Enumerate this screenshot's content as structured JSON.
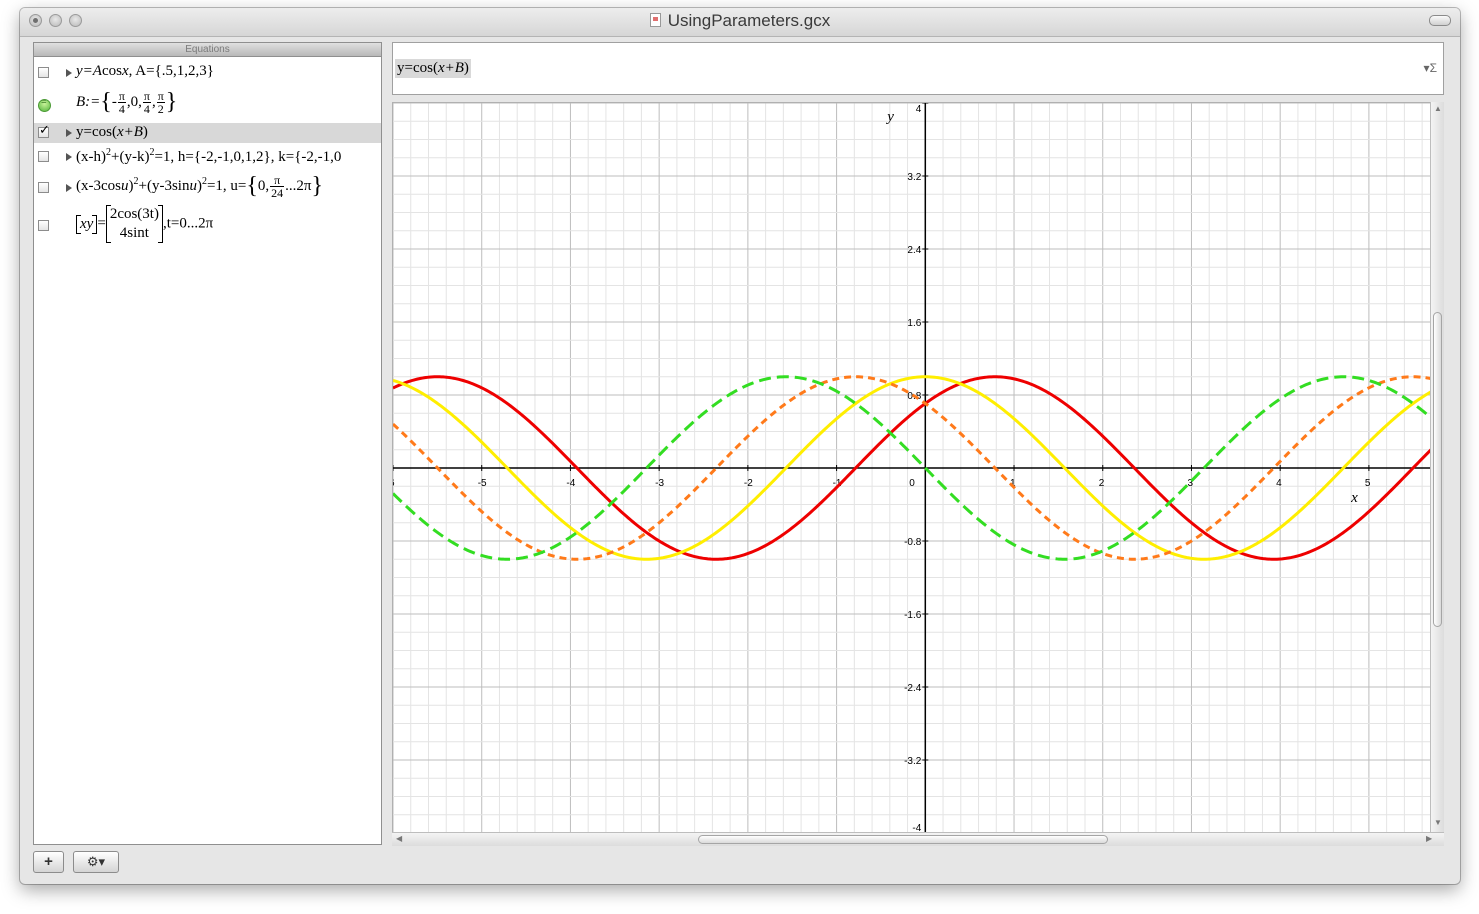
{
  "window": {
    "title": "UsingParameters.gcx"
  },
  "equations_panel": {
    "header": "Equations",
    "rows": [
      {
        "checked": false,
        "kind": "equation",
        "parts": [
          "y=A",
          "cos",
          "x",
          ", A={.5,1,2,3}"
        ]
      },
      {
        "kind": "parameter",
        "lhs": "B:=",
        "values": [
          "-",
          "π",
          "4",
          ",0,",
          "π",
          "4",
          ",",
          "π",
          "2"
        ]
      },
      {
        "checked": true,
        "kind": "equation",
        "parts": [
          "y=cos(",
          "x+B",
          ")"
        ]
      },
      {
        "checked": false,
        "kind": "equation",
        "parts": [
          "(x-h)",
          "2",
          "+(y-k)",
          "2",
          "=1, h={-2,-1,0,1,2}, k={-2,-1,0"
        ]
      },
      {
        "checked": false,
        "kind": "equation",
        "parts": [
          "(x-3cos",
          "u",
          ")",
          "2",
          "+(y-3sin",
          "u",
          ")",
          "2",
          "=1, u=",
          "0,",
          "π",
          "24",
          "...2π"
        ]
      },
      {
        "checked": false,
        "kind": "parametric",
        "matrix_left": [
          "x",
          "y"
        ],
        "matrix_right": [
          "2cos(3t)",
          "4sint"
        ],
        "range": ",t=0...2π"
      }
    ]
  },
  "input_bar": {
    "equation_prefix": "y=cos(",
    "equation_var": "x+B",
    "equation_suffix": ")",
    "sigma_label": "Σ"
  },
  "bottom_bar": {
    "add_label": "+",
    "gear_label": "⚙▾"
  },
  "colors": {
    "red": "#ee0000",
    "yellow": "#ffee00",
    "orange": "#ff7a1a",
    "green": "#33dd22",
    "grid_minor": "#e4e4e4",
    "grid_major": "#bdbdbd"
  },
  "chart_data": {
    "type": "line",
    "xlabel": "x",
    "ylabel": "y",
    "xlim": [
      -6,
      5.7
    ],
    "ylim": [
      -4,
      4
    ],
    "x_ticks": [
      "6",
      "-5",
      "-4",
      "-3",
      "-2",
      "-1",
      "0",
      "1",
      "2",
      "3",
      "4",
      "5"
    ],
    "y_ticks": [
      "4",
      "3.2",
      "2.4",
      "1.6",
      "0.8",
      "-0.8",
      "-1.6",
      "-2.4",
      "-3.2",
      "-4"
    ],
    "series": [
      {
        "expr": "cos(x-π/4)",
        "shift": -0.785398,
        "color": "#ee0000",
        "dash": "solid"
      },
      {
        "expr": "cos(x)",
        "shift": 0,
        "color": "#ffee00",
        "dash": "solid"
      },
      {
        "expr": "cos(x+π/4)",
        "shift": 0.785398,
        "color": "#ff7a1a",
        "dash": "dashed"
      },
      {
        "expr": "cos(x+π/2)",
        "shift": 1.570796,
        "color": "#33dd22",
        "dash": "dashed"
      }
    ]
  }
}
